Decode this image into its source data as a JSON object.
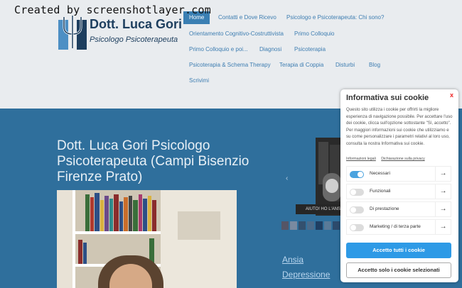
{
  "watermark": "Created by screenshotlayer.com",
  "logo": {
    "name": "Dott. Luca Gori",
    "subtitle": "Psicologo Psicoterapeuta"
  },
  "nav": [
    "Home",
    "Contatti e Dove Ricevo",
    "Psicologo e Psicoterapeuta: Chi sono?",
    "Orientamento Cognitivo-Costruttivista",
    "Primo Colloquio",
    "Primo Colloquio e poi...",
    "Diagnosi",
    "Psicoterapia",
    "Psicoterapia & Schema Therapy",
    "Terapia di Coppia",
    "Disturbi",
    "Blog",
    "Scrivimi"
  ],
  "hero": {
    "title": "Dott. Luca Gori Psicologo Psicoterapeuta (Campi Bisenzio Firenze Prato)"
  },
  "slider": {
    "caption": "AIUTO! HO L'ANSIA",
    "prev_icon": "chevron-left-icon"
  },
  "topics": [
    "Ansia",
    "Depressione"
  ],
  "cookie": {
    "title": "Informativa sui cookie",
    "close": "x",
    "text": "Questo sito utilizza i cookie per offrirti la migliore esperienza di navigazione possibile. Per accettare l'uso dei cookie, clicca sull'opzione sottostante \"Sì, accetto\". Per maggiori informazioni sui cookie che utilizziamo e su come personalizzare i parametri relativi al loro uso, consulta la nostra Informativa sui cookie.",
    "links": [
      "Informazioni legali",
      "Dichiarazione sulla privacy"
    ],
    "categories": [
      {
        "label": "Necessari",
        "enabled": true
      },
      {
        "label": "Funzionali",
        "enabled": false
      },
      {
        "label": "Di prestazione",
        "enabled": false
      },
      {
        "label": "Marketing / di terza parte",
        "enabled": false
      }
    ],
    "arrow": "→",
    "accept_all": "Accetto tutti i cookie",
    "accept_selected": "Accetto solo i cookie selezionati"
  },
  "colors": {
    "brand": "#2f6f9c",
    "accent": "#2d9ae6",
    "link": "#3d7db1"
  }
}
